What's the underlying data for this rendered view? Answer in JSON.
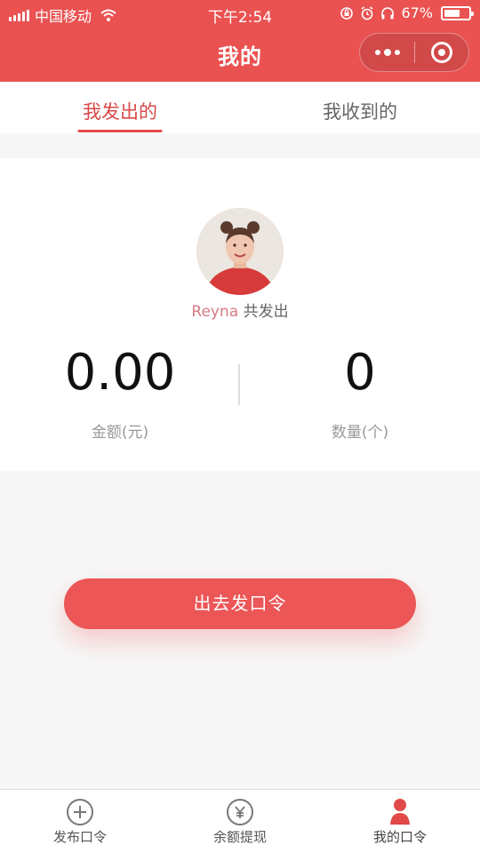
{
  "status_bar": {
    "carrier": "中国移动",
    "time": "下午2:54",
    "battery": "67%",
    "battery_level": 0.67
  },
  "nav": {
    "title": "我的"
  },
  "tabs": [
    {
      "label": "我发出的",
      "active": true
    },
    {
      "label": "我收到的",
      "active": false
    }
  ],
  "summary": {
    "username": "Reyna",
    "sent_suffix": "共发出",
    "amount_value": "0.00",
    "amount_label": "金额(元)",
    "count_value": "0",
    "count_label": "数量(个)"
  },
  "action": {
    "send_label": "出去发口令"
  },
  "tabbar": [
    {
      "label": "发布口令",
      "icon": "plus-circle-icon"
    },
    {
      "label": "余额提现",
      "icon": "yen-circle-icon"
    },
    {
      "label": "我的口令",
      "icon": "person-icon"
    }
  ],
  "colors": {
    "brand_red": "#ea5252",
    "active_tab": "#d94848",
    "username": "#d87a84"
  }
}
